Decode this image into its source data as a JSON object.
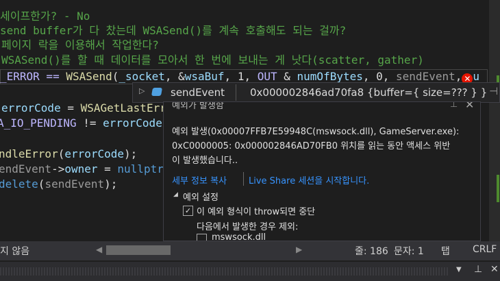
{
  "editor": {
    "comments": [
      "세이프한가? - No",
      "send buffer가 다 찼는데 WSASend()를 계속 호출해도 되는 걸까?",
      "페이지 락을 이용해서 작업한다?",
      "WSASend()를 할 때 데이터를 모아서 한 번에 보내는 게 낫다(scatter, gather)"
    ],
    "line_current": {
      "a": "_ERROR == ",
      "b": "WSASend",
      "c": "(",
      "d": "_socket",
      "e": ", &",
      "f": "wsaBuf",
      "g": ", 1, ",
      "h": "OUT",
      "i": " & ",
      "j": "numOfBytes",
      "k": ", 0, ",
      "l": "sendEvent",
      "m": ",",
      "n": "u"
    },
    "line1": {
      "a": "errorCode",
      "b": " = ",
      "c": "WSAGetLastErr"
    },
    "line2": {
      "a": "A_IO_PENDING",
      "b": " != ",
      "c": "errorCode"
    },
    "line3": {
      "a": "ndleError",
      "b": "(",
      "c": "errorCode",
      "d": ");"
    },
    "line4": {
      "a": "endEvent",
      "b": "->",
      "c": "owner",
      "d": " = ",
      "e": "nullptr"
    },
    "line5": {
      "a": "delete",
      "b": "(",
      "c": "sendEvent",
      "d": ");"
    }
  },
  "datatip": {
    "name": "sendEvent",
    "value": "0x000002846ad70fa8 {buffer={ size=??? } }"
  },
  "exception": {
    "title": "예외가 발생함",
    "message_lines": [
      "예외 발생(0x00007FFB7E59948C(mswsock.dll), GameServer.exe):",
      "0xC0000005: 0x000002846AD70FB0 위치를 읽는 동안 액세스 위반",
      "이 발생했습니다.."
    ],
    "copy_details": "세부 정보 복사",
    "live_share": "Live Share 세션을 시작합니다.",
    "settings_header": "예외 설정",
    "break_when_thrown": "이 예외 형식이 throw되면 중단",
    "break_checked": true,
    "except_when": "다음에서 발생한 경우 제외:",
    "module": "mswsock.dll"
  },
  "status": {
    "left": "지 않음",
    "line": "줄: 186",
    "col": "문자: 1",
    "tab": "탭",
    "eol": "CRLF"
  }
}
